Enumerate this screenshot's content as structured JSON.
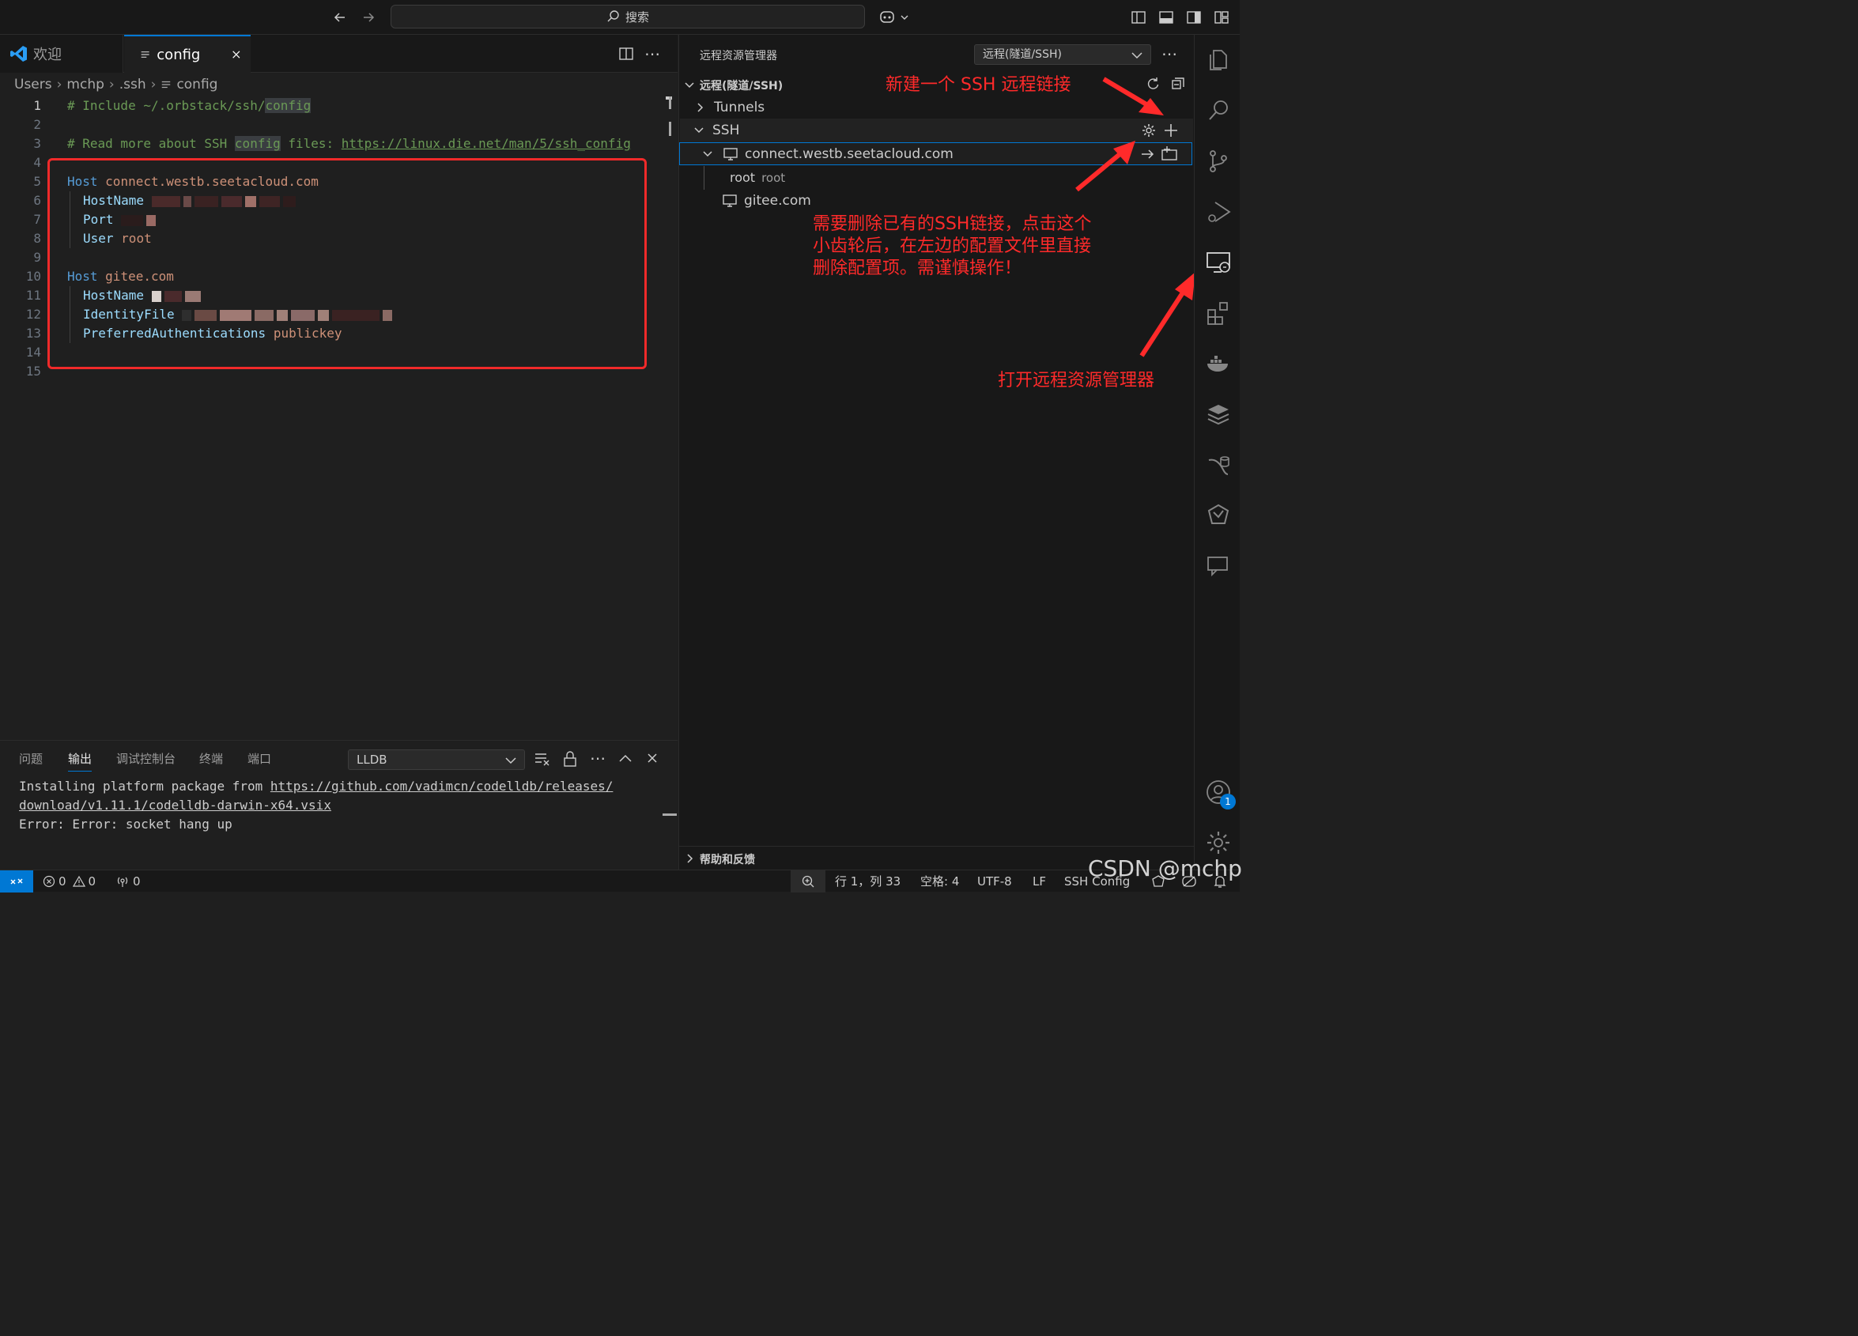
{
  "titlebar": {
    "search_placeholder": "搜索"
  },
  "tabs": [
    {
      "label": "欢迎"
    },
    {
      "label": "config"
    }
  ],
  "breadcrumb": [
    "Users",
    "mchp",
    ".ssh",
    "config"
  ],
  "editor": {
    "line_numbers": [
      "1",
      "2",
      "3",
      "4",
      "5",
      "6",
      "7",
      "8",
      "9",
      "10",
      "11",
      "12",
      "13",
      "14",
      "15"
    ],
    "l1_comment": "# Include ~/.orbstack/ssh/",
    "l1_hl": "config",
    "l3_a": "# Read more about SSH ",
    "l3_hl": "config",
    "l3_b": " files: ",
    "l3_url": "https://linux.die.net/man/5/ssh_config",
    "host_kw": "Host",
    "host1": "connect.westb.seetacloud.com",
    "hostname_kw": "HostName",
    "port_kw": "Port",
    "user_kw": "User",
    "user_val": "root",
    "host2": "gitee.com",
    "identity_kw": "IdentityFile",
    "pref_kw": "PreferredAuthentications",
    "pref_val": "publickey"
  },
  "panel": {
    "tabs": [
      "问题",
      "输出",
      "调试控制台",
      "终端",
      "端口"
    ],
    "channel": "LLDB",
    "out1_a": "Installing platform package from ",
    "out1_url": "https://github.com/vadimcn/codelldb/releases/",
    "out2_url": "download/v1.11.1/codelldb-darwin-x64.vsix",
    "out3": "Error: Error: socket hang up"
  },
  "sidebar": {
    "title": "远程资源管理器",
    "select_value": "远程(隧道/SSH)",
    "section": "远程(隧道/SSH)",
    "tunnels": "Tunnels",
    "ssh": "SSH",
    "host1": "connect.westb.seetacloud.com",
    "root_label": "root",
    "root_desc": "root",
    "host2": "gitee.com",
    "help": "帮助和反馈"
  },
  "annotations": {
    "new_ssh": "新建一个 SSH 远程链接",
    "delete_1": "需要删除已有的SSH链接，点击这个",
    "delete_2": "小齿轮后，在左边的配置文件里直接",
    "delete_3": "删除配置项。需谨慎操作！",
    "open_remote": "打开远程资源管理器"
  },
  "statusbar": {
    "errors": "0",
    "warnings": "0",
    "ports": "0",
    "position": "行 1，列 33",
    "spaces": "空格: 4",
    "encoding": "UTF-8",
    "eol": "LF",
    "language": "SSH Config"
  },
  "badge": "1",
  "watermark": "CSDN @mchp",
  "colors": {
    "accent": "#0078d4",
    "annotation": "#ff2a2a"
  }
}
